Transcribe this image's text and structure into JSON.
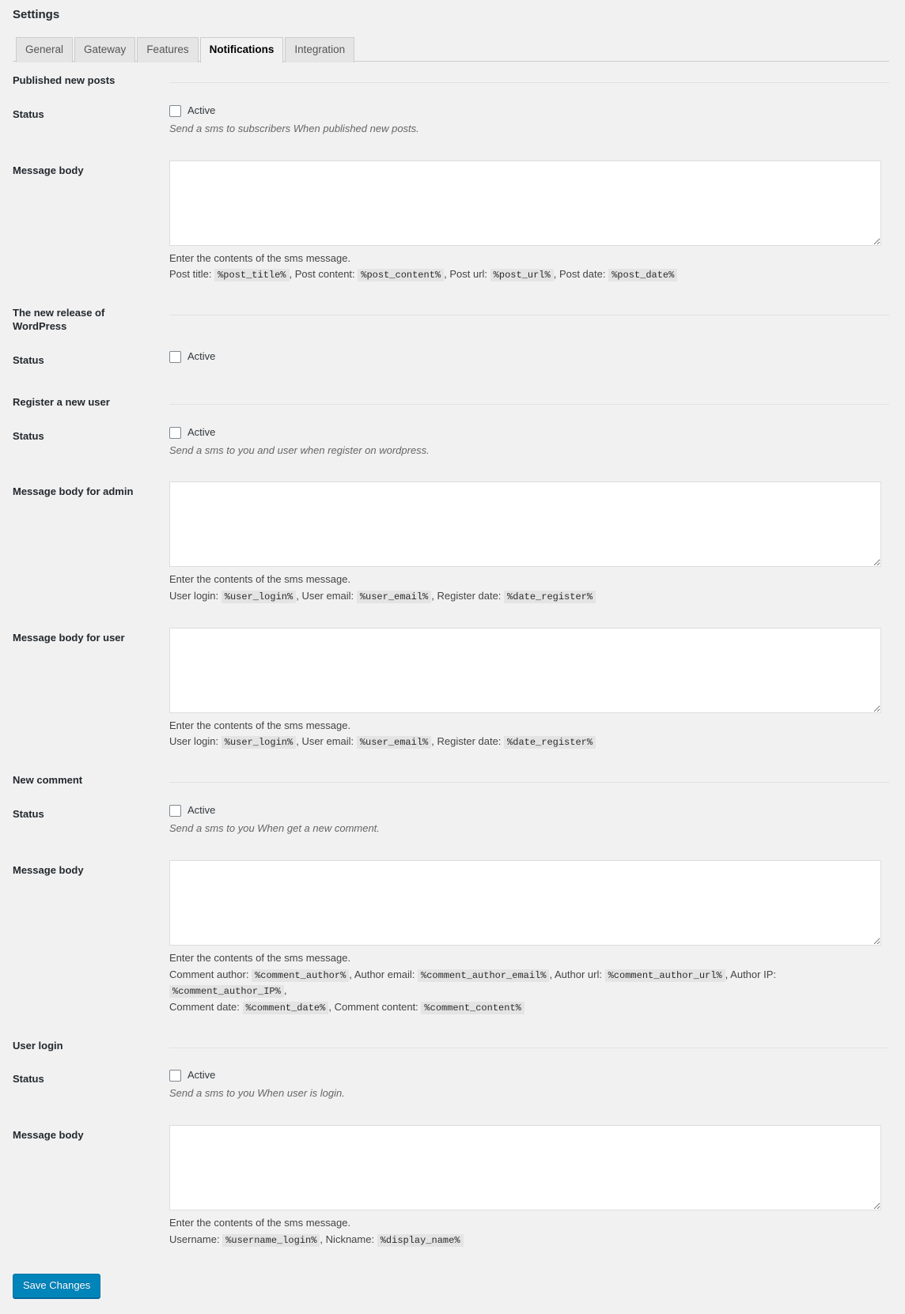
{
  "page": {
    "title": "Settings",
    "save_label": "Save Changes"
  },
  "tabs": [
    {
      "label": "General",
      "active": false
    },
    {
      "label": "Gateway",
      "active": false
    },
    {
      "label": "Features",
      "active": false
    },
    {
      "label": "Notifications",
      "active": true
    },
    {
      "label": "Integration",
      "active": false
    }
  ],
  "common": {
    "status_label": "Status",
    "active_label": "Active",
    "message_body_label": "Message body",
    "enter_contents": "Enter the contents of the sms message."
  },
  "sections": {
    "published_posts": {
      "heading": "Published new posts",
      "status_label": "Status",
      "active_label": "Active",
      "status_desc": "Send a sms to subscribers When published new posts.",
      "message_label": "Message body",
      "message_value": "",
      "help_intro": "Enter the contents of the sms message.",
      "tokens": [
        {
          "label": "Post title:",
          "code": "%post_title%",
          "trail": ","
        },
        {
          "label": "Post content:",
          "code": "%post_content%",
          "trail": ","
        },
        {
          "label": "Post url:",
          "code": "%post_url%",
          "trail": ","
        },
        {
          "label": "Post date:",
          "code": "%post_date%",
          "trail": ""
        }
      ]
    },
    "wp_release": {
      "heading": "The new release of WordPress",
      "status_label": "Status",
      "active_label": "Active"
    },
    "register_user": {
      "heading": "Register a new user",
      "status_label": "Status",
      "active_label": "Active",
      "status_desc": "Send a sms to you and user when register on wordpress.",
      "admin_message_label": "Message body for admin",
      "admin_message_value": "",
      "admin_help_intro": "Enter the contents of the sms message.",
      "admin_tokens": [
        {
          "label": "User login:",
          "code": "%user_login%",
          "trail": ","
        },
        {
          "label": "User email:",
          "code": "%user_email%",
          "trail": ","
        },
        {
          "label": "Register date:",
          "code": "%date_register%",
          "trail": ""
        }
      ],
      "user_message_label": "Message body for user",
      "user_message_value": "",
      "user_help_intro": "Enter the contents of the sms message.",
      "user_tokens": [
        {
          "label": "User login:",
          "code": "%user_login%",
          "trail": ","
        },
        {
          "label": "User email:",
          "code": "%user_email%",
          "trail": ","
        },
        {
          "label": "Register date:",
          "code": "%date_register%",
          "trail": ""
        }
      ]
    },
    "new_comment": {
      "heading": "New comment",
      "status_label": "Status",
      "active_label": "Active",
      "status_desc": "Send a sms to you When get a new comment.",
      "message_label": "Message body",
      "message_value": "",
      "help_intro": "Enter the contents of the sms message.",
      "tokens_line1": [
        {
          "label": "Comment author:",
          "code": "%comment_author%",
          "trail": ","
        },
        {
          "label": "Author email:",
          "code": "%comment_author_email%",
          "trail": ","
        },
        {
          "label": "Author url:",
          "code": "%comment_author_url%",
          "trail": ","
        },
        {
          "label": "Author IP:",
          "code": "%comment_author_IP%",
          "trail": ","
        }
      ],
      "tokens_line2": [
        {
          "label": "Comment date:",
          "code": "%comment_date%",
          "trail": ","
        },
        {
          "label": "Comment content:",
          "code": "%comment_content%",
          "trail": ""
        }
      ]
    },
    "user_login": {
      "heading": "User login",
      "status_label": "Status",
      "active_label": "Active",
      "status_desc": "Send a sms to you When user is login.",
      "message_label": "Message body",
      "message_value": "",
      "help_intro": "Enter the contents of the sms message.",
      "tokens": [
        {
          "label": "Username:",
          "code": "%username_login%",
          "trail": ","
        },
        {
          "label": "Nickname:",
          "code": "%display_name%",
          "trail": ""
        }
      ]
    }
  }
}
